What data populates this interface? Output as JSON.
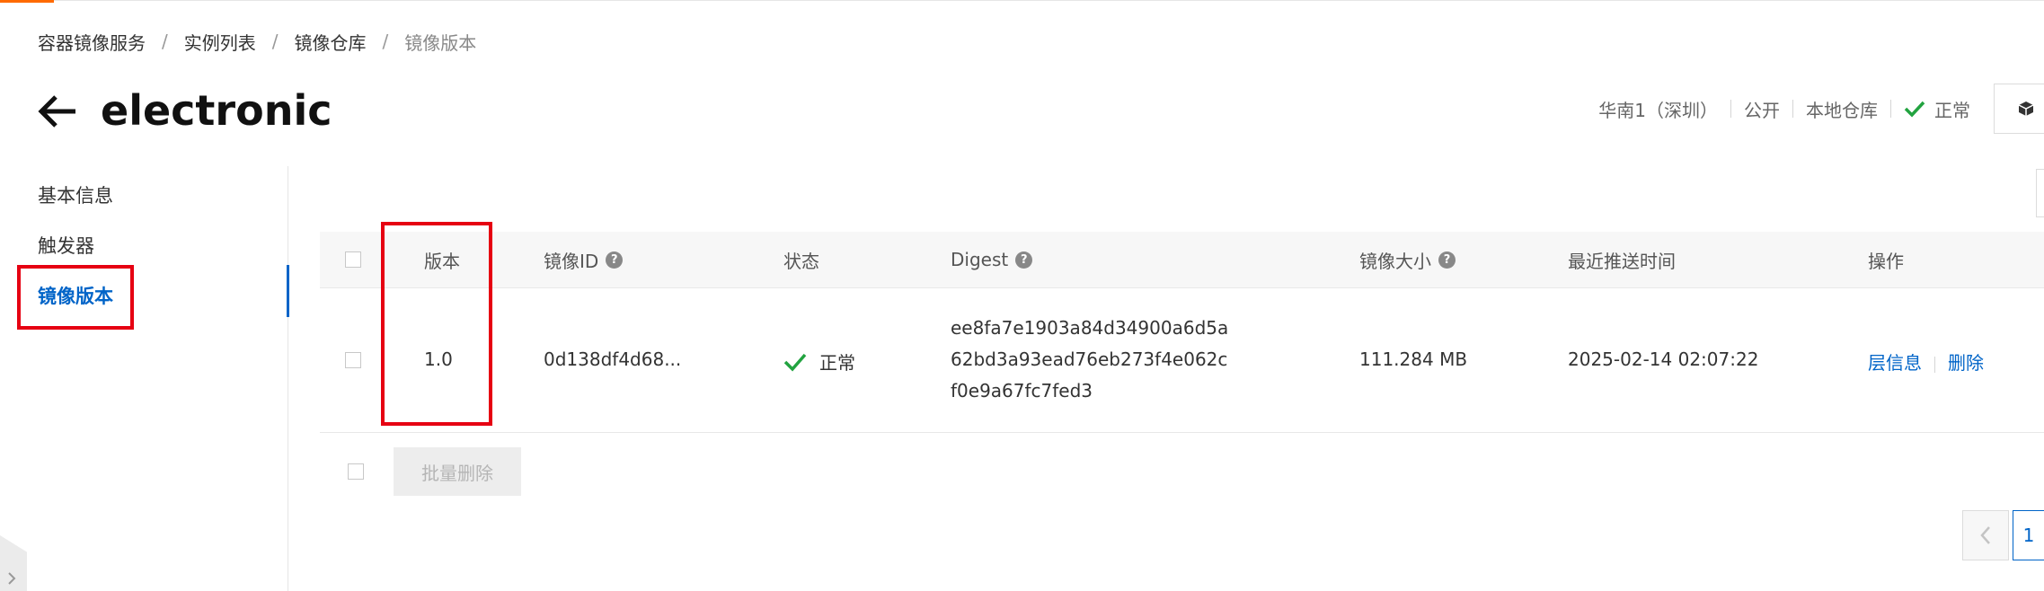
{
  "breadcrumb": {
    "items": [
      "容器镜像服务",
      "实例列表",
      "镜像仓库",
      "镜像版本"
    ],
    "separator": "/"
  },
  "header": {
    "title": "electronic",
    "region": "华南1（深圳）",
    "visibility": "公开",
    "repo_type": "本地仓库",
    "status": "正常"
  },
  "sidebar": {
    "items": [
      {
        "label": "基本信息"
      },
      {
        "label": "触发器"
      },
      {
        "label": "镜像版本"
      }
    ]
  },
  "table": {
    "columns": {
      "version": "版本",
      "image_id": "镜像ID",
      "status": "状态",
      "digest": "Digest",
      "size": "镜像大小",
      "pushed": "最近推送时间",
      "actions": "操作"
    },
    "rows": [
      {
        "version": "1.0",
        "image_id": "0d138df4d68...",
        "status": "正常",
        "digest_lines": [
          "ee8fa7e1903a84d34900a6d5a",
          "62bd3a93ead76eb273f4e062c",
          "f0e9a67fc7fed3"
        ],
        "size": "111.284 MB",
        "pushed": "2025-02-14 02:07:22",
        "action_layers": "层信息",
        "action_delete": "删除"
      }
    ]
  },
  "batch_delete_label": "批量删除",
  "pagination": {
    "current_page": "1"
  },
  "colors": {
    "accent_blue": "#0064c8",
    "success_green": "#22a340",
    "highlight_red": "#e60012",
    "brand_orange": "#ff6a00"
  }
}
